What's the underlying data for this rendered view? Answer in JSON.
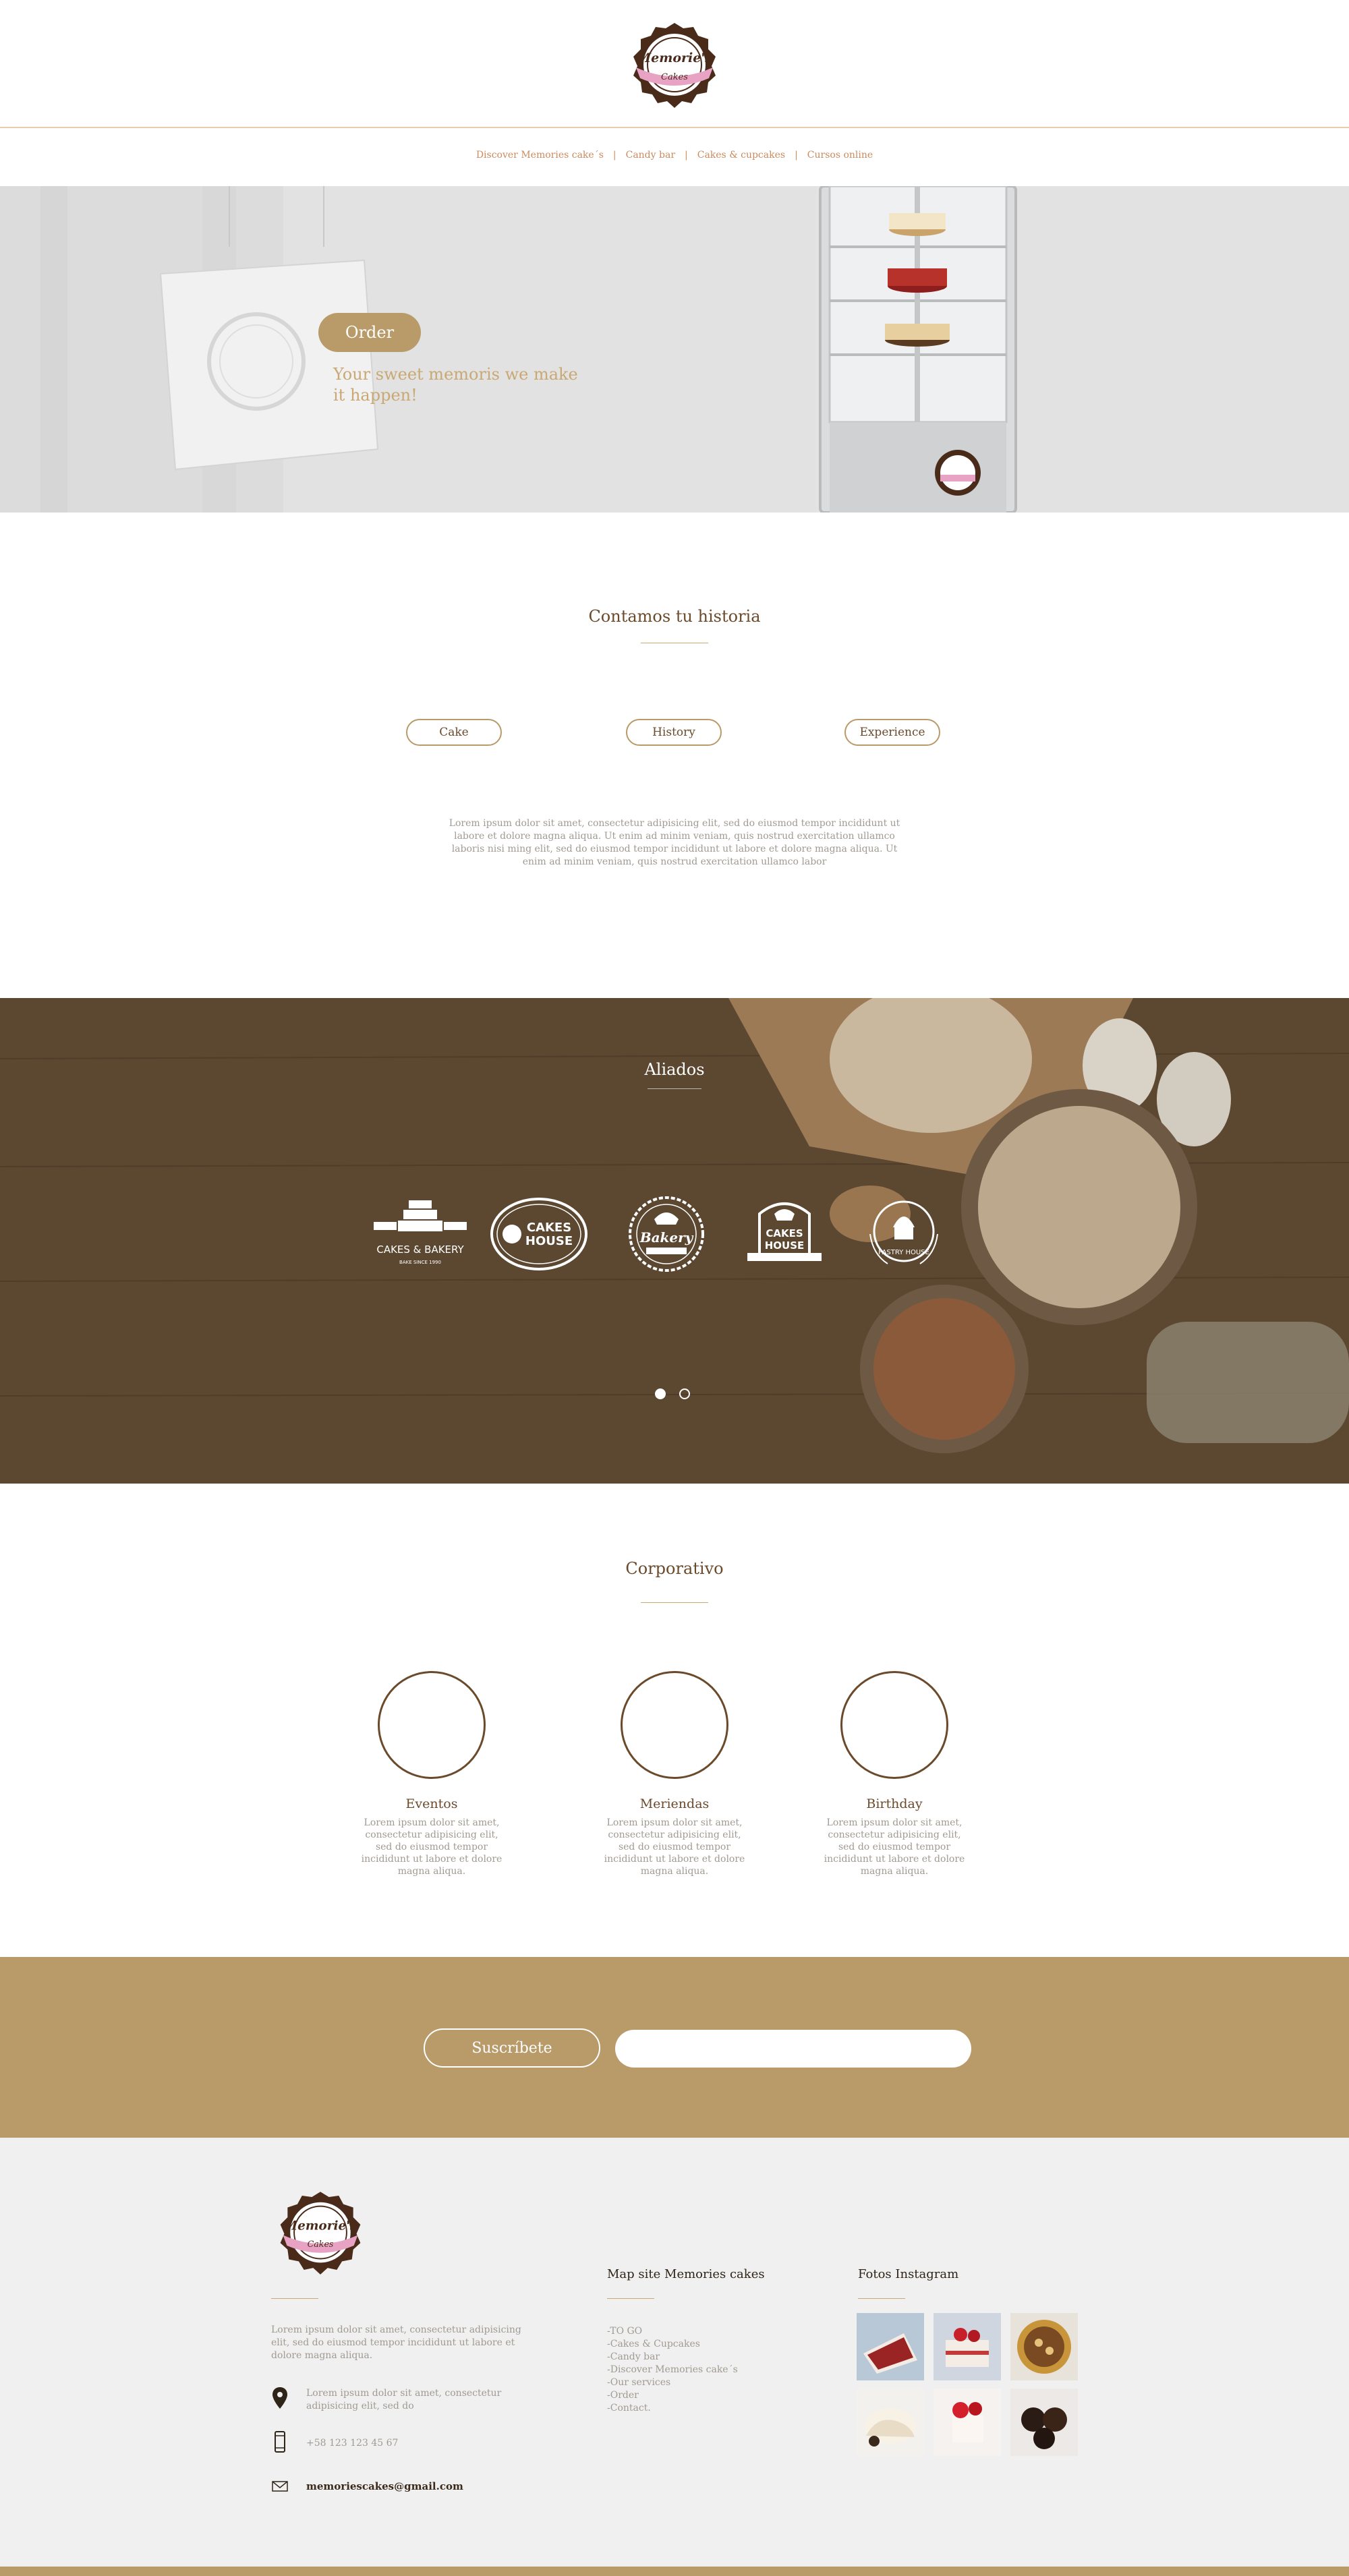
{
  "brand": {
    "logo_line1": "Memorie's",
    "logo_line2": "Cakes",
    "colors": {
      "accent": "#b99a69",
      "brown": "#6b4a2b",
      "muted": "#a09a92",
      "nav": "#c98b5f",
      "pink": "#e8a3c4"
    }
  },
  "nav": {
    "items": [
      "Discover Memories cake´s",
      "Candy bar",
      "Cakes & cupcakes",
      "Cursos online"
    ],
    "separator": "|"
  },
  "hero": {
    "order_label": "Order",
    "tagline": "Your sweet memoris we make it happen!"
  },
  "story": {
    "title": "Contamos tu historia",
    "tabs": [
      "Cake",
      "History",
      "Experience"
    ],
    "text": "Lorem ipsum dolor sit amet, consectetur adipisicing elit, sed do eiusmod tempor incididunt ut labore et dolore magna aliqua. Ut enim ad minim veniam, quis nostrud exercitation ullamco laboris nisi ming elit, sed do eiusmod tempor incididunt ut labore et dolore magna aliqua. Ut enim ad minim veniam, quis nostrud exercitation ullamco labor"
  },
  "allies": {
    "title": "Aliados",
    "logos": [
      {
        "name": "cakes-bakery",
        "line1": "CAKES & BAKERY",
        "line2": "BAKE SINCE 1990"
      },
      {
        "name": "cakes-house-1",
        "line1": "CAKES",
        "line2": "HOUSE"
      },
      {
        "name": "bakery",
        "line1": "Bakery",
        "line2": ""
      },
      {
        "name": "cakes-house-2",
        "line1": "CAKES",
        "line2": "HOUSE"
      },
      {
        "name": "pastry-house",
        "line1": "PASTRY HOUSE",
        "line2": ""
      }
    ],
    "active_slide": 1,
    "slide_count": 2
  },
  "corporate": {
    "title": "Corporativo",
    "items": [
      {
        "name": "Eventos",
        "text": "Lorem ipsum dolor sit amet, consectetur adipisicing elit, sed do eiusmod tempor incididunt ut labore et dolore magna aliqua."
      },
      {
        "name": "Meriendas",
        "text": "Lorem ipsum dolor sit amet, consectetur adipisicing elit, sed do eiusmod tempor incididunt ut labore et dolore magna aliqua."
      },
      {
        "name": "Birthday",
        "text": "Lorem ipsum dolor sit amet, consectetur adipisicing elit, sed do eiusmod tempor incididunt ut labore et dolore magna aliqua."
      }
    ]
  },
  "subscribe": {
    "button_label": "Suscríbete",
    "input_value": "",
    "input_placeholder": ""
  },
  "footer": {
    "desc": "Lorem ipsum dolor sit amet, consectetur adipisicing elit, sed do eiusmod tempor incididunt ut labore et dolore magna aliqua.",
    "address": "Lorem ipsum dolor sit amet, consectetur adipisicing elit, sed do",
    "phone": "+58 123 123 45 67",
    "email": "memoriescakes@gmail.com",
    "map_title": "Map site Memories cakes",
    "map_items": [
      "-TO GO",
      "-Cakes & Cupcakes",
      "-Candy bar",
      "-Discover Memories cake´s",
      "-Our services",
      "-Order",
      "-Contact."
    ],
    "insta_title": "Fotos Instagram",
    "insta_photos": [
      "red-velvet-slice",
      "strawberry-cake",
      "cookie-tart",
      "meringue-dessert",
      "berry-cream-cake",
      "chocolate-truffles"
    ]
  }
}
